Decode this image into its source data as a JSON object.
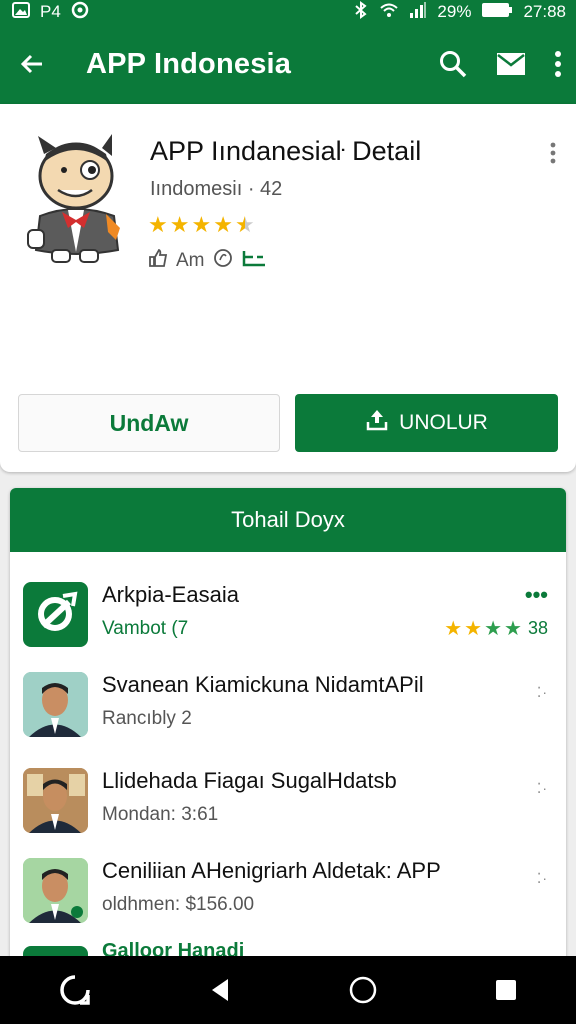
{
  "status": {
    "carrier": "P4",
    "battery": "29%",
    "time": "27:88"
  },
  "toolbar": {
    "title": "APP Indonesia"
  },
  "detail": {
    "title": "APP Iındanesiaŀ Detail",
    "subtitle": "Iındomesiı · 42",
    "rating_fraction": 0.85,
    "meta_text": "Am",
    "outline_button": "UndAw",
    "fill_button": "UNOLUR"
  },
  "list": {
    "header": "Tohail Doyx",
    "items": [
      {
        "name": "Arkpia-Easaia",
        "sub": "Vambot (7",
        "rating": "38"
      },
      {
        "name": "Svanean Kiamickuna NidamtAPil",
        "sub": "Rancıbly 2"
      },
      {
        "name": "Llidehada Fiagaı SugalHdatsb",
        "sub": "Mondan: 3:61"
      },
      {
        "name": "Ceniliian AHenigriarh Aldetak: APP",
        "sub": "oldhmen: $156.00"
      }
    ],
    "peek_text": "Galloor Hanadi"
  },
  "colors": {
    "brand": "#0b7a3a",
    "star": "#f4b400"
  }
}
